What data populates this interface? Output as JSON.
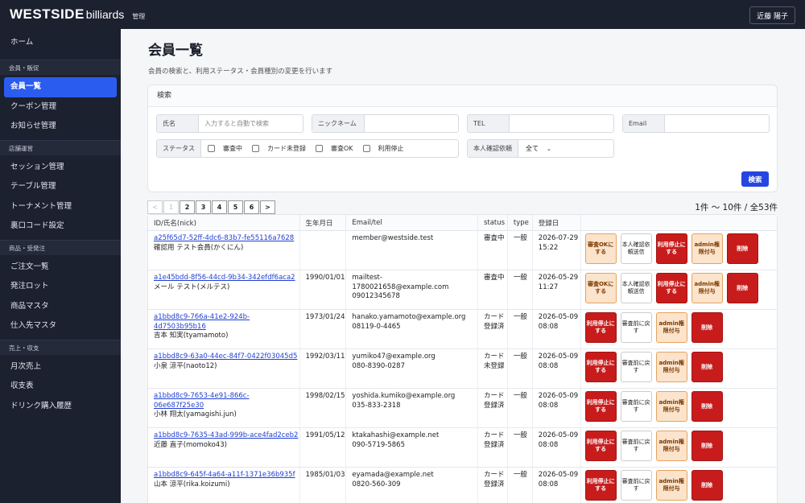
{
  "header": {
    "logo_main": "WESTSIDE",
    "logo_sub": "billiards",
    "admin_label": "管理",
    "user_name": "近藤 陽子"
  },
  "sidebar": {
    "home": "ホーム",
    "sections": [
      {
        "title": "会員・販促",
        "items": [
          "会員一覧",
          "クーポン管理",
          "お知らせ管理"
        ]
      },
      {
        "title": "店舗運営",
        "items": [
          "セッション管理",
          "テーブル管理",
          "トーナメント管理",
          "裏口コード設定"
        ]
      },
      {
        "title": "商品・受発注",
        "items": [
          "ご注文一覧",
          "発注ロット",
          "商品マスタ",
          "仕入先マスタ"
        ]
      },
      {
        "title": "売上・収支",
        "items": [
          "月次売上",
          "収支表",
          "ドリンク購入履歴"
        ]
      }
    ],
    "active": "会員一覧"
  },
  "page": {
    "title": "会員一覧",
    "description": "会員の検索と、利用ステータス・会員種別の変更を行います"
  },
  "search": {
    "heading": "検索",
    "name_label": "氏名",
    "name_placeholder": "入力すると自動で検索",
    "nick_label": "ニックネーム",
    "tel_label": "TEL",
    "email_label": "Email",
    "status_label": "ステータス",
    "status_options": [
      "審査中",
      "カード未登録",
      "審査OK",
      "利用停止"
    ],
    "verify_label": "本人確認依頼",
    "verify_value": "全て",
    "submit": "検索"
  },
  "pager": {
    "prev": "<",
    "pages": [
      "1",
      "2",
      "3",
      "4",
      "5",
      "6"
    ],
    "next": ">",
    "count": "1件 〜 10件 / 全53件"
  },
  "table": {
    "headers": [
      "ID/氏名(nick)",
      "生年月日",
      "Email/tel",
      "status",
      "type",
      "登録日"
    ],
    "rows": [
      {
        "id": "a25f65d7-52ff-4dc6-83b7-fe55116a7628",
        "name": "確認用 テスト会員(かくにん)",
        "birth": "",
        "email": "member@westside.test",
        "tel": "",
        "status": "審査中",
        "type": "一般",
        "date": "2026-07-29",
        "time": "15:22"
      },
      {
        "id": "a1e45bdd-8f56-44cd-9b34-342efdf6aca2",
        "name": "メール テスト(メルテス)",
        "birth": "1990/01/01",
        "email": "mailtest-1780021658@example.com",
        "tel": "09012345678",
        "status": "審査中",
        "type": "一般",
        "date": "2026-05-29",
        "time": "11:27"
      },
      {
        "id": "a1bbd8c9-766a-41e2-924b-4d7503b95b16",
        "name": "吉本 知実(tyamamoto)",
        "birth": "1973/01/24",
        "email": "hanako.yamamoto@example.org",
        "tel": "08119-0-4465",
        "status": "カード登録済",
        "type": "一般",
        "date": "2026-05-09",
        "time": "08:08"
      },
      {
        "id": "a1bbd8c9-63a0-44ec-84f7-0422f03045d5",
        "name": "小泉 涼平(naoto12)",
        "birth": "1992/03/11",
        "email": "yumiko47@example.org",
        "tel": "080-8390-0287",
        "status": "カード未登録",
        "type": "一般",
        "date": "2026-05-09",
        "time": "08:08"
      },
      {
        "id": "a1bbd8c9-7653-4e91-866c-06e687f25e30",
        "name": "小林 翔太(yamagishi.jun)",
        "birth": "1998/02/15",
        "email": "yoshida.kumiko@example.org",
        "tel": "035-833-2318",
        "status": "カード登録済",
        "type": "一般",
        "date": "2026-05-09",
        "time": "08:08"
      },
      {
        "id": "a1bbd8c9-7635-43ad-999b-ace4fad2ceb2",
        "name": "近藤 直子(momoko43)",
        "birth": "1991/05/12",
        "email": "ktakahashi@example.net",
        "tel": "090-5719-5865",
        "status": "カード登録済",
        "type": "一般",
        "date": "2026-05-09",
        "time": "08:08"
      },
      {
        "id": "a1bbd8c9-645f-4a64-a11f-1371e36b935f",
        "name": "山本 涼平(rika.koizumi)",
        "birth": "1985/01/03",
        "email": "eyamada@example.net",
        "tel": "0820-560-309",
        "status": "カード登録済",
        "type": "一般",
        "date": "2026-05-09",
        "time": "08:08"
      }
    ],
    "actions_pending": [
      "審査OKにする",
      "本人確認依頼送信",
      "利用停止にする",
      "admin権限付与",
      "削除"
    ],
    "actions_active": [
      "利用停止にする",
      "審査前に戻す",
      "admin権限付与",
      "削除"
    ]
  }
}
